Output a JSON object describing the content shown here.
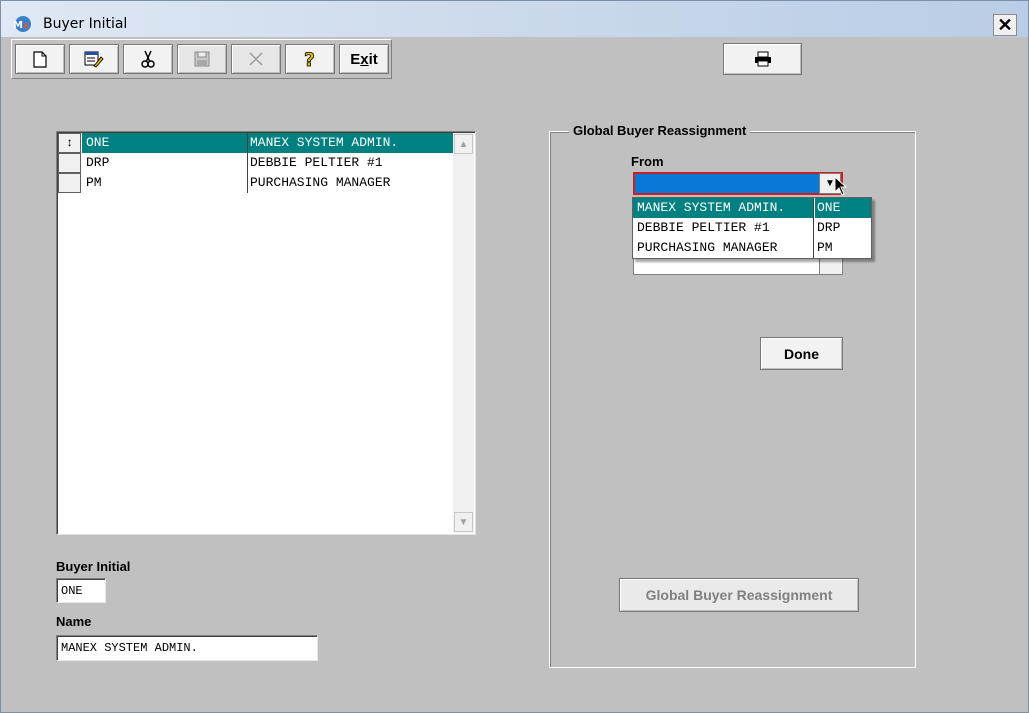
{
  "window": {
    "title": "Buyer Initial",
    "close_label": "✕"
  },
  "toolbar": {
    "buttons": [
      {
        "name": "new-button",
        "icon": "new-document-icon",
        "enabled": true
      },
      {
        "name": "edit-button",
        "icon": "edit-icon",
        "enabled": true
      },
      {
        "name": "delete-button",
        "icon": "scissors-icon",
        "enabled": true
      },
      {
        "name": "save-button",
        "icon": "save-icon",
        "enabled": false
      },
      {
        "name": "cancel-button",
        "icon": "x-icon",
        "enabled": false
      },
      {
        "name": "help-button",
        "icon": "question-icon",
        "enabled": true
      }
    ],
    "exit_label_prefix": "E",
    "exit_label_hotkey": "x",
    "exit_label_suffix": "it",
    "print_icon": "printer-icon"
  },
  "grid": {
    "rows": [
      {
        "initial": "ONE",
        "name": "MANEX SYSTEM ADMIN.",
        "selected": true
      },
      {
        "initial": "DRP",
        "name": "DEBBIE PELTIER #1",
        "selected": false
      },
      {
        "initial": "PM",
        "name": "PURCHASING MANAGER",
        "selected": false
      }
    ],
    "current_row_marker": "↕"
  },
  "form": {
    "buyer_initial_label": "Buyer Initial",
    "buyer_initial_value": "ONE",
    "name_label": "Name",
    "name_value": "MANEX SYSTEM ADMIN."
  },
  "reassign": {
    "group_title": "Global Buyer Reassignment",
    "from_label": "From",
    "from_value": "",
    "dropdown_options": [
      {
        "name": "MANEX SYSTEM ADMIN.",
        "initial": "ONE",
        "highlighted": true
      },
      {
        "name": "DEBBIE PELTIER #1",
        "initial": "DRP",
        "highlighted": false
      },
      {
        "name": "PURCHASING MANAGER",
        "initial": "PM",
        "highlighted": false
      }
    ],
    "done_label": "Done",
    "global_button_label": "Global Buyer Reassignment",
    "global_button_enabled": false
  },
  "colors": {
    "selection": "#008080",
    "window_bg": "#c0c0c0",
    "combo_active": "#0a78d7"
  }
}
